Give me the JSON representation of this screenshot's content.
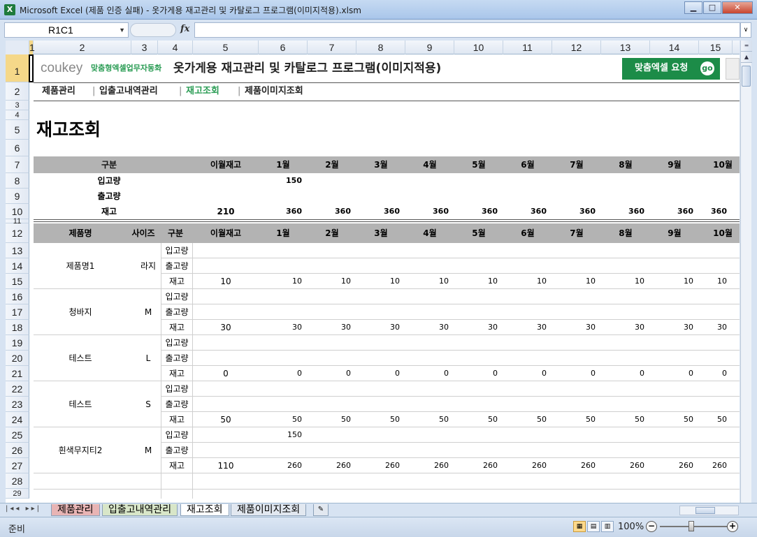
{
  "window": {
    "title": "Microsoft Excel (제품 인증 실패) - 옷가게용 재고관리 및 카탈로그 프로그램(이미지적용).xlsm",
    "app_icon": "X"
  },
  "formula_bar": {
    "name_box": "R1C1",
    "fx": "fx",
    "value": ""
  },
  "columns": [
    "1",
    "2",
    "3",
    "4",
    "5",
    "6",
    "7",
    "8",
    "9",
    "10",
    "11",
    "12",
    "13",
    "14",
    "15"
  ],
  "rows": [
    "1",
    "2",
    "3",
    "4",
    "5",
    "6",
    "7",
    "8",
    "9",
    "10",
    "11",
    "12",
    "13",
    "14",
    "15",
    "16",
    "17",
    "18",
    "19",
    "20",
    "21",
    "22",
    "23",
    "24",
    "25",
    "26",
    "27",
    "28",
    "29"
  ],
  "sheet": {
    "logo_main": "coukey",
    "logo_sub": "맞춤형엑셀업무자동화",
    "title": "옷가게용 재고관리 및 카탈로그 프로그램(이미지적용)",
    "cta_label": "맞춤엑셀 요청",
    "cta_go": "go",
    "nav": [
      "제품관리",
      "입출고내역관리",
      "재고조회",
      "제품이미지조회"
    ],
    "nav_sep": "|",
    "heading": "재고조회",
    "summary": {
      "header": [
        "구분",
        "이월재고",
        "1월",
        "2월",
        "3월",
        "4월",
        "5월",
        "6월",
        "7월",
        "8월",
        "9월",
        "10월"
      ],
      "rows": [
        {
          "label": "입고량",
          "carry": "",
          "months": [
            "150",
            "",
            "",
            "",
            "",
            "",
            "",
            "",
            "",
            ""
          ]
        },
        {
          "label": "출고량",
          "carry": "",
          "months": [
            "",
            "",
            "",
            "",
            "",
            "",
            "",
            "",
            "",
            ""
          ]
        },
        {
          "label": "재고",
          "carry": "210",
          "months": [
            "360",
            "360",
            "360",
            "360",
            "360",
            "360",
            "360",
            "360",
            "360",
            "360"
          ]
        }
      ]
    },
    "detail": {
      "header": [
        "제품명",
        "사이즈",
        "구분",
        "이월재고",
        "1월",
        "2월",
        "3월",
        "4월",
        "5월",
        "6월",
        "7월",
        "8월",
        "9월",
        "10월"
      ],
      "kinds": [
        "입고량",
        "출고량",
        "재고"
      ],
      "products": [
        {
          "name": "제품명1",
          "size": "라지",
          "in": [
            "",
            "",
            "",
            "",
            "",
            "",
            "",
            "",
            "",
            ""
          ],
          "carry": "10",
          "stock": [
            "10",
            "10",
            "10",
            "10",
            "10",
            "10",
            "10",
            "10",
            "10",
            "10"
          ]
        },
        {
          "name": "청바지",
          "size": "M",
          "in": [
            "",
            "",
            "",
            "",
            "",
            "",
            "",
            "",
            "",
            ""
          ],
          "carry": "30",
          "stock": [
            "30",
            "30",
            "30",
            "30",
            "30",
            "30",
            "30",
            "30",
            "30",
            "30"
          ]
        },
        {
          "name": "테스트",
          "size": "L",
          "in": [
            "",
            "",
            "",
            "",
            "",
            "",
            "",
            "",
            "",
            ""
          ],
          "carry": "0",
          "stock": [
            "0",
            "0",
            "0",
            "0",
            "0",
            "0",
            "0",
            "0",
            "0",
            "0"
          ]
        },
        {
          "name": "테스트",
          "size": "S",
          "in": [
            "",
            "",
            "",
            "",
            "",
            "",
            "",
            "",
            "",
            ""
          ],
          "carry": "50",
          "stock": [
            "50",
            "50",
            "50",
            "50",
            "50",
            "50",
            "50",
            "50",
            "50",
            "50"
          ]
        },
        {
          "name": "흰색무지티2",
          "size": "M",
          "in": [
            "150",
            "",
            "",
            "",
            "",
            "",
            "",
            "",
            "",
            ""
          ],
          "carry": "110",
          "stock": [
            "260",
            "260",
            "260",
            "260",
            "260",
            "260",
            "260",
            "260",
            "260",
            "260"
          ]
        }
      ]
    }
  },
  "tabs": [
    "제품관리",
    "입출고내역관리",
    "재고조회",
    "제품이미지조회"
  ],
  "status": {
    "ready": "준비",
    "zoom": "100%"
  }
}
